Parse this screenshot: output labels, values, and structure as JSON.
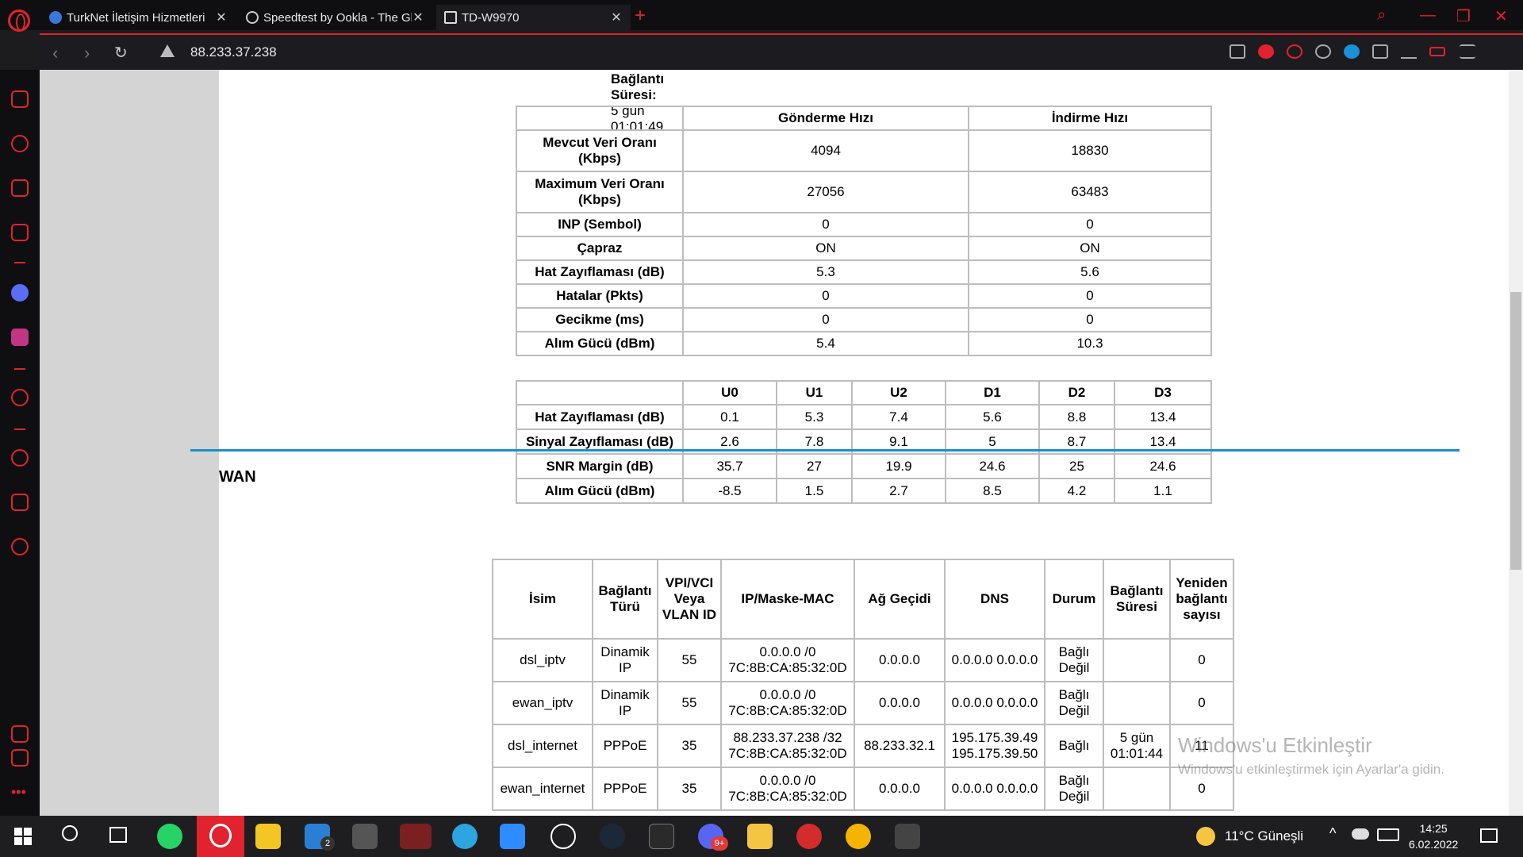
{
  "browser": {
    "tabs": [
      {
        "label": "TurkNet İletişim Hizmetleri",
        "active": false
      },
      {
        "label": "Speedtest by Ookla - The Gl",
        "active": false
      },
      {
        "label": "TD-W9970",
        "active": true
      }
    ],
    "url": "88.233.37.238"
  },
  "status": {
    "conn_label": "Bağlantı Süresi:",
    "conn_value": "5 gün 01:01:49"
  },
  "dsl_table": {
    "headers": [
      "",
      "Gönderme Hızı",
      "İndirme Hızı"
    ],
    "rows": [
      {
        "label": "Mevcut Veri Oranı (Kbps)",
        "up": "4094",
        "down": "18830"
      },
      {
        "label": "Maximum Veri Oranı (Kbps)",
        "up": "27056",
        "down": "63483"
      },
      {
        "label": "INP (Sembol)",
        "up": "0",
        "down": "0"
      },
      {
        "label": "Çapraz",
        "up": "ON",
        "down": "ON"
      },
      {
        "label": "Hat Zayıflaması (dB)",
        "up": "5.3",
        "down": "5.6"
      },
      {
        "label": "Hatalar (Pkts)",
        "up": "0",
        "down": "0"
      },
      {
        "label": "Gecikme (ms)",
        "up": "0",
        "down": "0"
      },
      {
        "label": "Alım Gücü (dBm)",
        "up": "5.4",
        "down": "10.3"
      }
    ]
  },
  "band_table": {
    "headers": [
      "",
      "U0",
      "U1",
      "U2",
      "D1",
      "D2",
      "D3"
    ],
    "rows": [
      {
        "label": "Hat Zayıflaması (dB)",
        "values": [
          "0.1",
          "5.3",
          "7.4",
          "5.6",
          "8.8",
          "13.4"
        ]
      },
      {
        "label": "Sinyal Zayıflaması (dB)",
        "values": [
          "2.6",
          "7.8",
          "9.1",
          "5",
          "8.7",
          "13.4"
        ]
      },
      {
        "label": "SNR Margin (dB)",
        "values": [
          "35.7",
          "27",
          "19.9",
          "24.6",
          "25",
          "24.6"
        ]
      },
      {
        "label": "Alım Gücü (dBm)",
        "values": [
          "-8.5",
          "1.5",
          "2.7",
          "8.5",
          "4.2",
          "1.1"
        ]
      }
    ]
  },
  "wan": {
    "title": "WAN",
    "headers": [
      "İsim",
      "Bağlantı Türü",
      "VPI/VCI Veya VLAN ID",
      "IP/Maske-MAC",
      "Ağ Geçidi",
      "DNS",
      "Durum",
      "Bağlantı Süresi",
      "Yeniden bağlantı sayısı"
    ],
    "rows": [
      {
        "name": "dsl_iptv",
        "type": "Dinamik IP",
        "vlan": "55",
        "ip": "0.0.0.0 /0",
        "mac": "7C:8B:CA:85:32:0D",
        "gw": "0.0.0.0",
        "dns": "0.0.0.0 0.0.0.0",
        "status": "Bağlı Değil",
        "uptime": "",
        "reconnects": "0"
      },
      {
        "name": "ewan_iptv",
        "type": "Dinamik IP",
        "vlan": "55",
        "ip": "0.0.0.0 /0",
        "mac": "7C:8B:CA:85:32:0D",
        "gw": "0.0.0.0",
        "dns": "0.0.0.0 0.0.0.0",
        "status": "Bağlı Değil",
        "uptime": "",
        "reconnects": "0"
      },
      {
        "name": "dsl_internet",
        "type": "PPPoE",
        "vlan": "35",
        "ip": "88.233.37.238 /32",
        "mac": "7C:8B:CA:85:32:0D",
        "gw": "88.233.32.1",
        "dns": "195.175.39.49 195.175.39.50",
        "status": "Bağlı",
        "uptime": "5 gün 01:01:44",
        "reconnects": "11"
      },
      {
        "name": "ewan_internet",
        "type": "PPPoE",
        "vlan": "35",
        "ip": "0.0.0.0 /0",
        "mac": "7C:8B:CA:85:32:0D",
        "gw": "0.0.0.0",
        "dns": "0.0.0.0 0.0.0.0",
        "status": "Bağlı Değil",
        "uptime": "",
        "reconnects": "0"
      }
    ]
  },
  "watermark": {
    "line1": "Windows'u Etkinleştir",
    "line2": "Windows'u etkinleştirmek için Ayarlar'a gidin."
  },
  "taskbar": {
    "weather": "11°C Güneşli",
    "time": "14:25",
    "date": "6.02.2022",
    "mail_badge": "2",
    "discord_badge": "9+"
  },
  "colors": {
    "accent": "#e0232e",
    "divider": "#1a90c8"
  }
}
